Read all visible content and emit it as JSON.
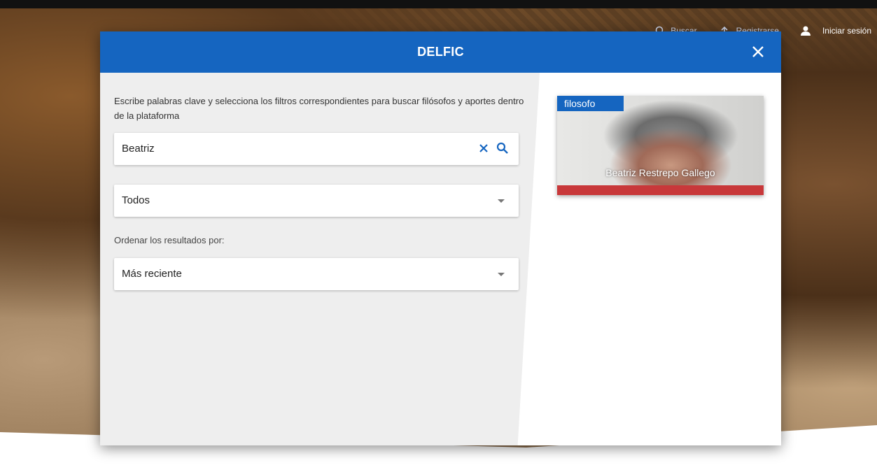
{
  "nav": {
    "search_label": "Buscar",
    "register_label": "Registrarse",
    "login_label": "Iniciar sesión"
  },
  "modal": {
    "title": "DELFIC",
    "intro": "Escribe palabras clave y selecciona los filtros correspondientes para buscar filósofos y aportes dentro de la plataforma",
    "search_value": "Beatriz",
    "filter_selected": "Todos",
    "order_label": "Ordenar los resultados por:",
    "order_selected": "Más reciente"
  },
  "results": [
    {
      "badge": "filosofo",
      "name": "Beatriz Restrepo Gallego"
    }
  ],
  "colors": {
    "primary": "#1565c0",
    "panel_bg": "#eeeeee"
  },
  "icons": {
    "close": "close-icon",
    "search": "search-icon",
    "clear": "clear-icon",
    "user": "user-icon",
    "register": "register-icon"
  }
}
